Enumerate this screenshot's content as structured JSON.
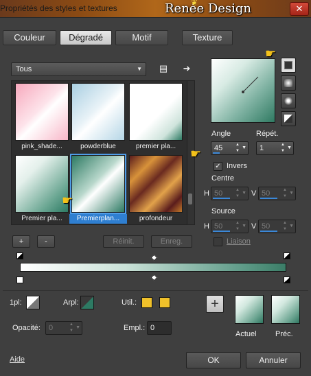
{
  "window": {
    "title": "Propriétés des styles et textures",
    "brand": "Renée Design",
    "close_icon": "close-icon"
  },
  "tabs": [
    {
      "label": "Couleur"
    },
    {
      "label": "Dégradé",
      "active": true
    },
    {
      "label": "Motif"
    },
    {
      "label": "Texture"
    }
  ],
  "category": {
    "selected": "Tous"
  },
  "gallery": {
    "items": [
      {
        "label": "pink_shade...",
        "colors": [
          "#f9b7c8",
          "#ffffff"
        ]
      },
      {
        "label": "powderblue",
        "colors": [
          "#b8d7e6",
          "#ffffff"
        ]
      },
      {
        "label": "premier pla...",
        "colors": [
          "#2d7a63",
          "#ffffff"
        ]
      },
      {
        "label": "Premier pla...",
        "colors": [
          "#2d7a63",
          "#ffffff"
        ]
      },
      {
        "label": "Premierplan...",
        "colors": [
          "#2d7a63",
          "#ffffff"
        ],
        "selected": true
      },
      {
        "label": "profondeur",
        "colors": [
          "#7a2a1e",
          "#d88a2a"
        ]
      }
    ]
  },
  "gradient": {
    "angle_label": "Angle",
    "angle_value": "45",
    "repeat_label": "Répét.",
    "repeat_value": "1",
    "invert_label": "Invers",
    "invert_checked": true,
    "center_label": "Centre",
    "center_h": "50",
    "center_v": "50",
    "source_label": "Source",
    "source_h": "50",
    "source_v": "50",
    "h_label": "H",
    "v_label": "V",
    "link_label": "Liaison"
  },
  "editor": {
    "add_label": "+",
    "remove_label": "-",
    "reset_label": "Réinit.",
    "save_label": "Enreg."
  },
  "bottom": {
    "first_plane_label": "1pl:",
    "back_plane_label": "Arpl:",
    "util_label": "Util.:",
    "opacity_label": "Opacité:",
    "opacity_value": "0",
    "empl_label": "Empl.:",
    "empl_value": "0",
    "current_label": "Actuel",
    "previous_label": "Préc."
  },
  "footer": {
    "help_label": "Aide",
    "ok_label": "OK",
    "cancel_label": "Annuler"
  },
  "colors": {
    "accent": "#3b88d8",
    "tube_green": "#2d7a63",
    "util_yellow": "#f0c12a"
  }
}
